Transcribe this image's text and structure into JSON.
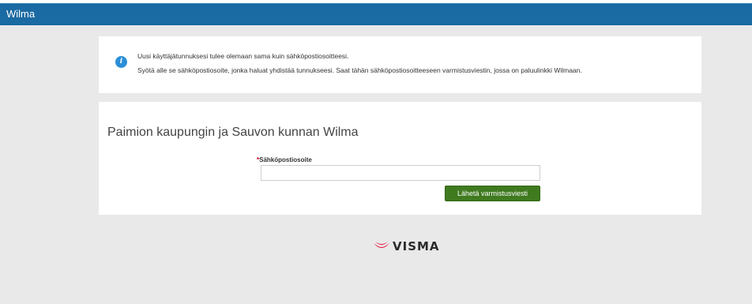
{
  "header": {
    "app_title": "Wilma",
    "bar_color": "#1a6aa3"
  },
  "info": {
    "icon": "info-icon",
    "icon_glyph": "i",
    "line1": "Uusi käyttäjätunnuksesi tulee olemaan sama kuin sähköpostiosoitteesi.",
    "line2": "Syötä alle se sähköpostiosoite, jonka haluat yhdistää tunnukseesi. Saat tähän sähköpostiosoitteeseen varmistusviestin, jossa on paluulinkki Wilmaan."
  },
  "form": {
    "title": "Paimion kaupungin ja Sauvon kunnan Wilma",
    "required_mark": "*",
    "email_label": "Sähköpostiosoite",
    "email_value": "",
    "email_placeholder": "",
    "submit_label": "Lähetä varmistusviesti",
    "submit_color": "#3f7a1f"
  },
  "footer": {
    "logo_icon": "visma-logo-icon",
    "logo_text": "VISMA",
    "logo_color": "#e4032e"
  }
}
